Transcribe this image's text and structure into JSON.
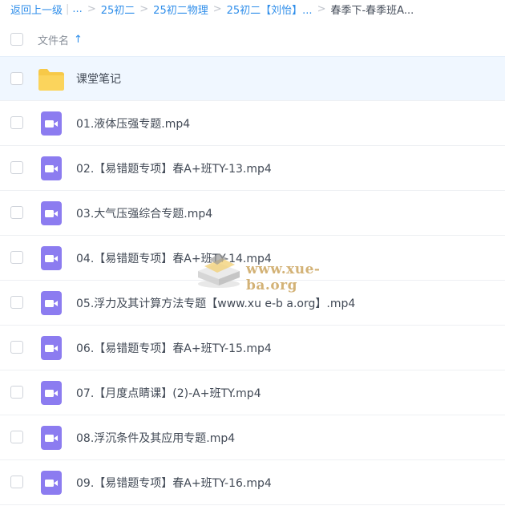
{
  "breadcrumb": {
    "back_label": "返回上一级",
    "ellipsis": "...",
    "items": [
      "25初二",
      "25初二物理",
      "25初二【刘怡】..."
    ],
    "current": "春季下-春季班A..."
  },
  "header": {
    "name_label": "文件名",
    "sort_icon": "↑"
  },
  "files": [
    {
      "name": "课堂笔记",
      "type": "folder"
    },
    {
      "name": "01.液体压强专题.mp4",
      "type": "video"
    },
    {
      "name": "02.【易错题专项】春A+班TY-13.mp4",
      "type": "video"
    },
    {
      "name": "03.大气压强综合专题.mp4",
      "type": "video"
    },
    {
      "name": "04.【易错题专项】春A+班TY-14.mp4",
      "type": "video"
    },
    {
      "name": "05.浮力及其计算方法专题【www.xu e-b a.org】.mp4",
      "type": "video"
    },
    {
      "name": "06.【易错题专项】春A+班TY-15.mp4",
      "type": "video"
    },
    {
      "name": "07.【月度点睛课】(2)-A+班TY.mp4",
      "type": "video"
    },
    {
      "name": "08.浮沉条件及其应用专题.mp4",
      "type": "video"
    },
    {
      "name": "09.【易错题专项】春A+班TY-16.mp4",
      "type": "video"
    }
  ],
  "watermark": {
    "text": "www.xue-ba.org"
  },
  "colors": {
    "accent": "#2f8eea",
    "folder": "#f7c948",
    "video": "#8c7cf0",
    "selected_row": "#f0f7ff"
  }
}
